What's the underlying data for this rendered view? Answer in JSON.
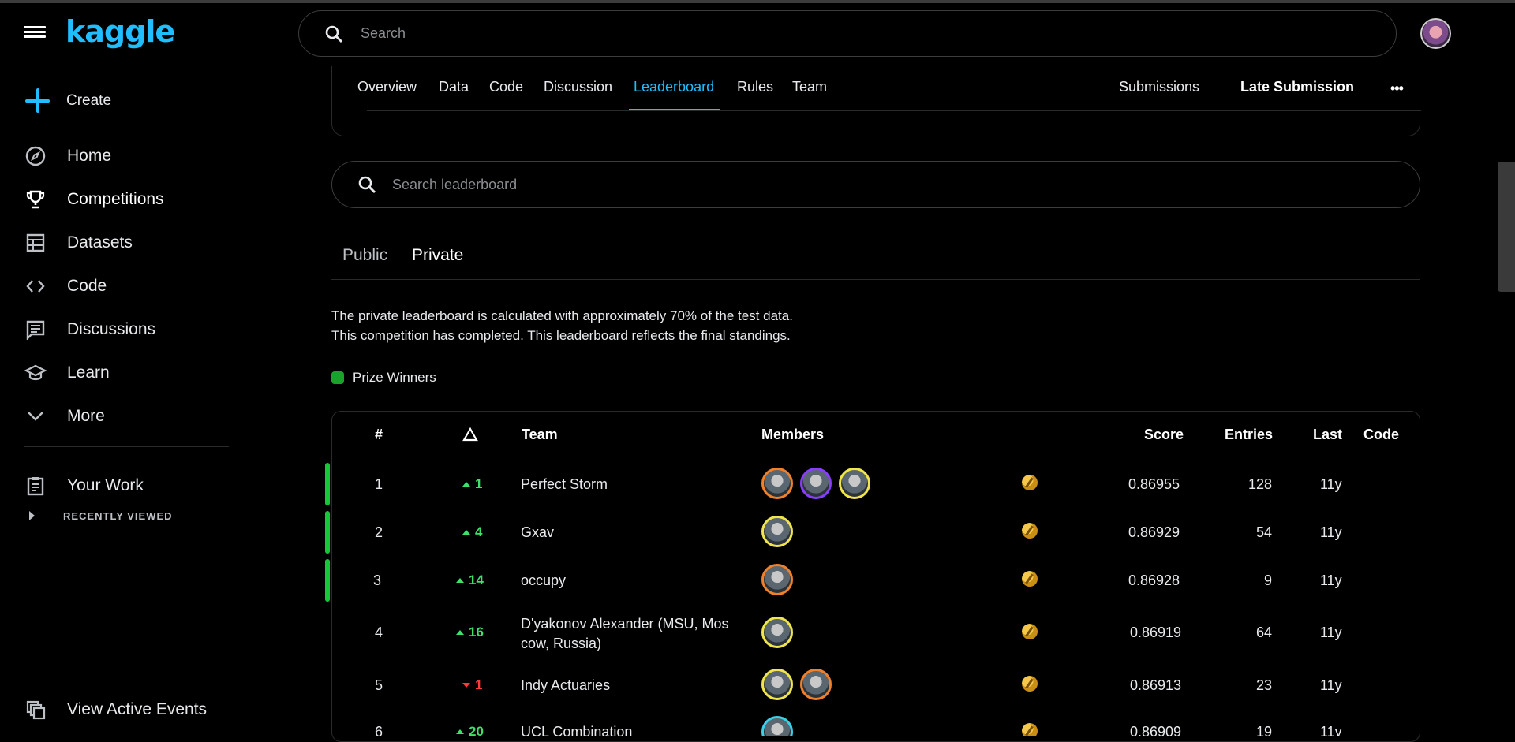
{
  "app": {
    "logo": "kaggle"
  },
  "sidebar": {
    "create_label": "Create",
    "items": [
      {
        "label": "Home",
        "icon": "compass-icon"
      },
      {
        "label": "Competitions",
        "icon": "trophy-icon"
      },
      {
        "label": "Datasets",
        "icon": "table-icon"
      },
      {
        "label": "Code",
        "icon": "code-icon"
      },
      {
        "label": "Discussions",
        "icon": "comment-icon"
      },
      {
        "label": "Learn",
        "icon": "graduation-cap-icon"
      },
      {
        "label": "More",
        "icon": "chevron-down-icon"
      }
    ],
    "your_work": "Your Work",
    "recently_viewed": "RECENTLY VIEWED",
    "view_active_events": "View Active Events"
  },
  "header": {
    "search_placeholder": "Search"
  },
  "tabs": {
    "items": [
      "Overview",
      "Data",
      "Code",
      "Discussion",
      "Leaderboard",
      "Rules",
      "Team"
    ],
    "active": "Leaderboard",
    "submissions": "Submissions",
    "late_submission": "Late Submission"
  },
  "leaderboard": {
    "search_placeholder": "Search leaderboard",
    "subtabs": {
      "public": "Public",
      "private": "Private"
    },
    "description_line1": "The private leaderboard is calculated with approximately 70% of the test data.",
    "description_line2": "This competition has completed. This leaderboard reflects the final standings.",
    "prize_label": "Prize Winners",
    "columns": {
      "rank": "#",
      "team": "Team",
      "members": "Members",
      "score": "Score",
      "entries": "Entries",
      "last": "Last",
      "code": "Code"
    },
    "rows": [
      {
        "rank": "1",
        "delta": "1",
        "dir": "up",
        "team": "Perfect Storm",
        "members": 3,
        "score": "0.86955",
        "entries": "128",
        "last": "11y",
        "prize": true
      },
      {
        "rank": "2",
        "delta": "4",
        "dir": "up",
        "team": "Gxav",
        "members": 1,
        "score": "0.86929",
        "entries": "54",
        "last": "11y",
        "prize": true
      },
      {
        "rank": "3",
        "delta": "14",
        "dir": "up",
        "team": "occupy",
        "members": 1,
        "score": "0.86928",
        "entries": "9",
        "last": "11y",
        "prize": true
      },
      {
        "rank": "4",
        "delta": "16",
        "dir": "up",
        "team_line1": "D'yakonov Alexander (MSU, Mos",
        "team_line2": "cow, Russia)",
        "members": 1,
        "score": "0.86919",
        "entries": "64",
        "last": "11y",
        "prize": false
      },
      {
        "rank": "5",
        "delta": "1",
        "dir": "down",
        "team": "Indy Actuaries",
        "members": 2,
        "score": "0.86913",
        "entries": "23",
        "last": "11y",
        "prize": false
      },
      {
        "rank": "6",
        "delta": "20",
        "dir": "up",
        "team": "UCL Combination",
        "members": 1,
        "score": "0.86909",
        "entries": "19",
        "last": "11y",
        "prize": false
      }
    ]
  },
  "colors": {
    "accent": "#20beff",
    "prize": "#1aa32a",
    "up": "#3ee06a",
    "down": "#ff3a3a"
  }
}
